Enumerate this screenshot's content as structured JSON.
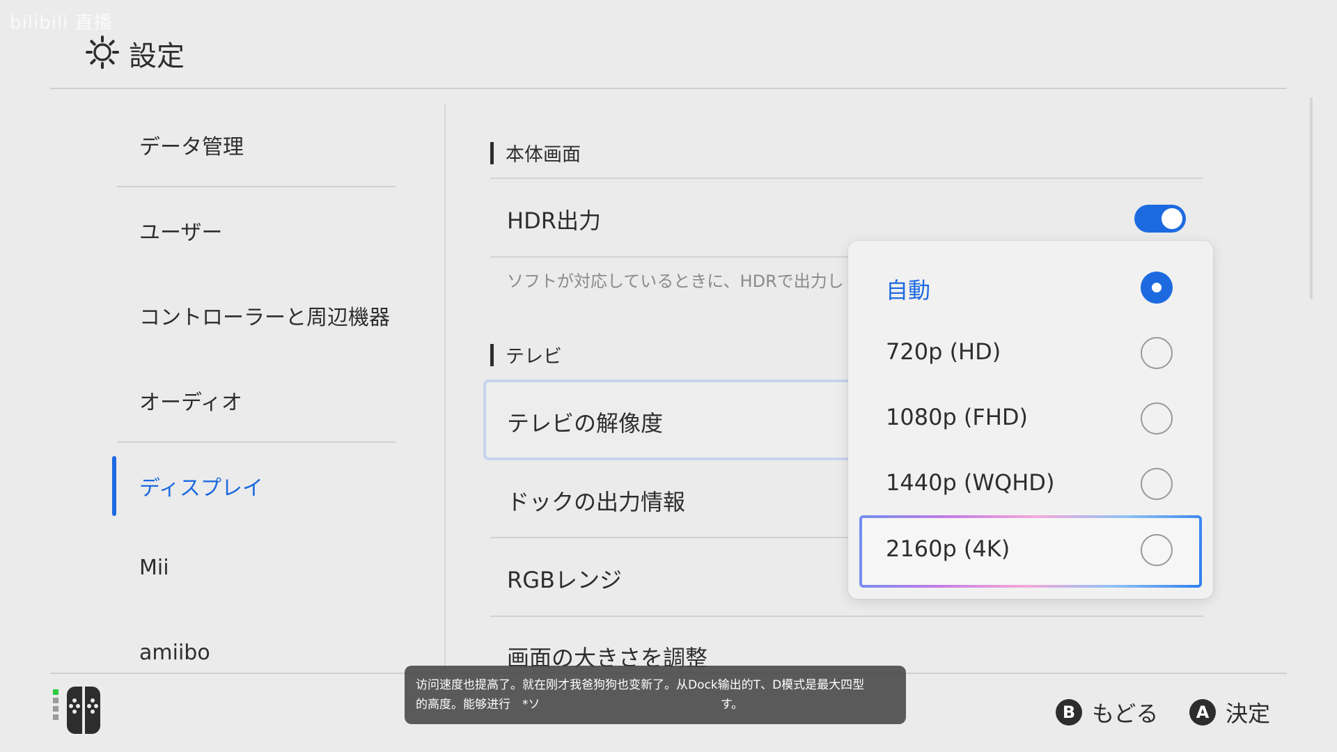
{
  "watermark": "bilibili 直播",
  "header": {
    "title": "設定"
  },
  "sidebar": {
    "items": [
      {
        "label": "データ管理"
      },
      {
        "label": "ユーザー"
      },
      {
        "label": "コントローラーと周辺機器"
      },
      {
        "label": "オーディオ"
      },
      {
        "label": "ディスプレイ",
        "active": true
      },
      {
        "label": "Mii"
      },
      {
        "label": "amiibo"
      }
    ]
  },
  "main": {
    "section_body": "本体画面",
    "hdr_label": "HDR出力",
    "hdr_enabled": true,
    "hdr_desc": "ソフトが対応しているときに、HDRで出力し",
    "section_tv": "テレビ",
    "tv_resolution": "テレビの解像度",
    "dock_info": "ドックの出力情報",
    "rgb_range": "RGBレンジ",
    "screen_size": "画面の大きさを調整"
  },
  "dropdown": {
    "options": [
      {
        "label": "自動",
        "selected": true
      },
      {
        "label": "720p (HD)",
        "selected": false
      },
      {
        "label": "1080p (FHD)",
        "selected": false
      },
      {
        "label": "1440p (WQHD)",
        "selected": false
      },
      {
        "label": "2160p (4K)",
        "selected": false
      }
    ]
  },
  "footer": {
    "back_key": "B",
    "back_label": "もどる",
    "ok_key": "A",
    "ok_label": "決定"
  },
  "subtitle": {
    "line1": "访问速度也提高了。就在刚才我爸狗狗也变新了。从Dock输出的T、D模式是最大四型",
    "line2": "的高度。能够进行　*ソ                                                す。"
  },
  "colors": {
    "accent": "#1d6ae0",
    "background": "#ebebeb",
    "text": "#2d2d2d"
  }
}
